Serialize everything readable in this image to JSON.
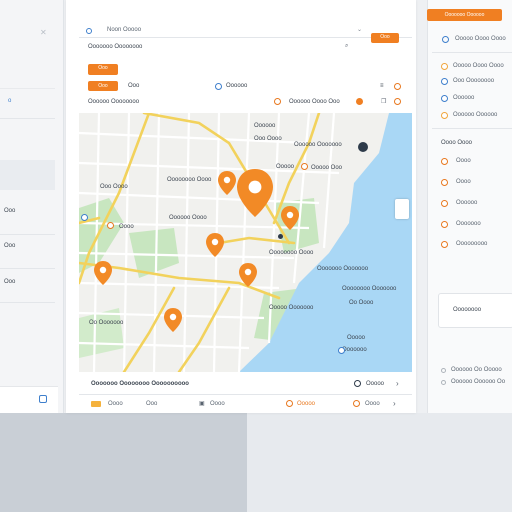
{
  "left": {
    "items": [
      "Ooo",
      "Ooo",
      "Ooo"
    ]
  },
  "header": {
    "title": "Noon Ooooo",
    "action_label": "Ooo"
  },
  "toolbar": {
    "label": "Ooooooo Oooooooo",
    "badge_label": "Ooo",
    "search_hint": "Oooooo"
  },
  "filters": {
    "primary_label": "Ooo",
    "chip1": "Ooo",
    "chip2": "Oooooo",
    "location_label": "Oooooo Oooooooo",
    "chip3": "Oooooo Oooo Ooo"
  },
  "map": {
    "labels": [
      "Oooooo Ooooooo",
      "Oooooo",
      "Ooo Oooo",
      "Ooooo",
      "Ooooo Ooo",
      "Ooo Oooo",
      "Oooooooo Oooo",
      "Oooooo Oooo",
      "Oooo",
      "Oooooooo Oooo",
      "Ooooooo Ooooooo",
      "Oooooooo Ooooooo",
      "Oo Oooo",
      "Ooooo Ooooooo",
      "Oo Ooooooo",
      "Ooooo",
      "Ooooooo"
    ]
  },
  "bottom": {
    "summary": "Ooooooo Oooooooo Oooooooooo",
    "action": "Ooooo",
    "tabs": [
      "Oooo",
      "Ooo",
      "Oooo",
      "Ooooo",
      "Oooo"
    ]
  },
  "right": {
    "top_button": "Ooooooo Oooooo",
    "sub_label": "Ooooo Oooo Oooo",
    "list": [
      "Ooooo Oooo Oooo",
      "Ooo Oooooooo",
      "Oooooo",
      "Oooooo Oooooo"
    ],
    "section_title": "Oooo Oooo",
    "options": [
      "Oooo",
      "Oooo",
      "Oooooo",
      "Ooooooo",
      "Ooooooooo"
    ],
    "confirm": "Oooooooo",
    "footer1": "Oooooo Oo Ooooo",
    "footer2": "Oooooo Oooooo Oo"
  },
  "colors": {
    "accent": "#f07f22",
    "water": "#a9d7f5",
    "park": "#c8e6c0",
    "road": "#f2d25c"
  }
}
